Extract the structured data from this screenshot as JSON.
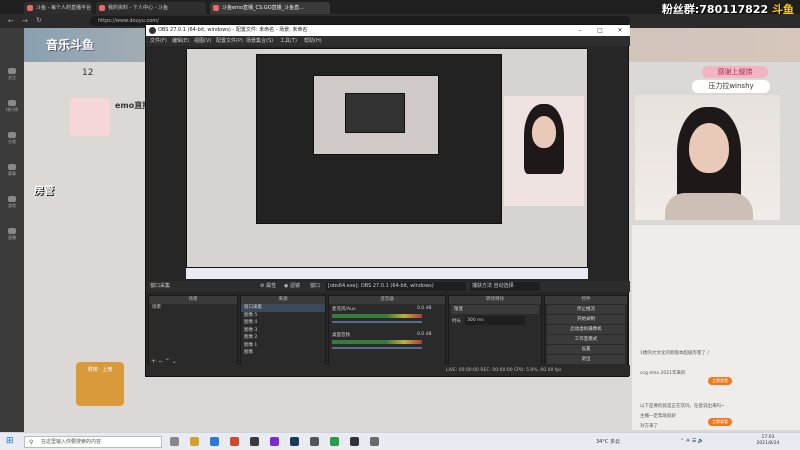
{
  "browser": {
    "tabs": [
      "斗鱼 - 每个人的直播平台",
      "我的资料 - 个人中心 - 斗鱼",
      "斗鱼emo直播_CS:GO直播_斗鱼直..."
    ],
    "url": "https://www.douyu.com/"
  },
  "overlay": {
    "fans_group": "粉丝群:780117822",
    "douyu_logo": "斗鱼",
    "sticker_thanks": "感谢上舰捞",
    "sticker_name": "压力拉winshy",
    "fangguan": "房管"
  },
  "site": {
    "banner_logo": "音乐斗鱼",
    "follower_count": "12",
    "streamer_name": "emo直播",
    "rank_label": "周榜 · 上榜",
    "side_nav": [
      "关注",
      "排行榜",
      "分类",
      "赛事",
      "游戏",
      "直播"
    ],
    "chat_lines": [
      "1楼的大文化的新版本超级厉害了 /",
      "ccg emo 2021年来的",
      "以下是要的就是正在玩吗，任意说出来吗~",
      "主播一定帮助就好",
      "对方来了"
    ],
    "chat_btn": "立即观看"
  },
  "obs": {
    "title": "OBS 27.0.1 (64-bit, windows) - 配置文件: 未命名 - 场景: 未命名",
    "menu": [
      "文件(F)",
      "编辑(E)",
      "视图(V)",
      "配置文件(P)",
      "场景集合(S)",
      "工具(T)",
      "帮助(H)"
    ],
    "toolbar": {
      "source_label": "窗口采集",
      "props": "属性",
      "filters": "滤镜",
      "window": "窗口",
      "window_value": "[obs64.exe]: OBS 27.0.1 (64-bit, windows)",
      "capture_method": "捕获方法 自动选择"
    },
    "scenes": {
      "header": "场景",
      "items": [
        "场景"
      ]
    },
    "sources": {
      "header": "来源",
      "items": [
        "窗口采集",
        "图像 5",
        "图像 4",
        "图像 3",
        "图像 2",
        "图像 1",
        "图像"
      ]
    },
    "mixer": {
      "header": "混音器",
      "tracks": [
        {
          "name": "麦克风/Aux",
          "db": "0.0 dB"
        },
        {
          "name": "桌面音频",
          "db": "0.0 dB"
        }
      ]
    },
    "transitions": {
      "header": "转场特效",
      "type": "渐变",
      "duration_label": "时长",
      "duration": "300 ms"
    },
    "controls": {
      "header": "控件",
      "buttons": [
        "停止推流",
        "开始录制",
        "启动虚拟摄像机",
        "工作室模式",
        "设置",
        "退出"
      ]
    },
    "status": "LIVE: 00:00:00   REC: 00:00:00   CPU: 5.0%, 60.00 fps"
  },
  "taskbar": {
    "search_placeholder": "在这里输入你要搜索的内容",
    "temperature": "34°C",
    "weather": "多云",
    "time": "17:03",
    "date": "2021/8/24"
  }
}
